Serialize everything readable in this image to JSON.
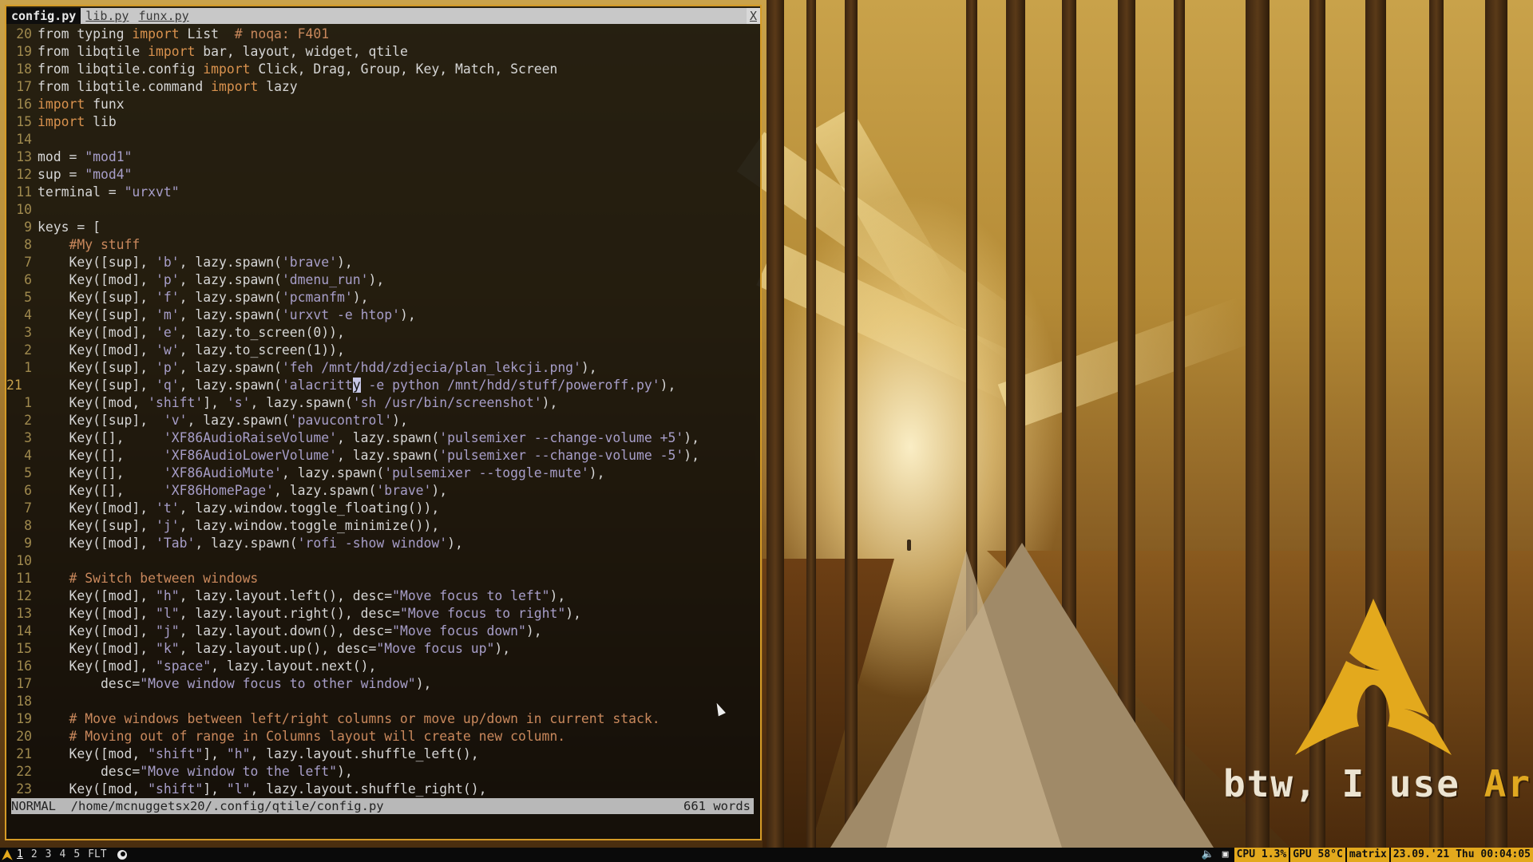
{
  "colors": {
    "accent": "#e3a91d",
    "border": "#d49a26",
    "keyword": "#d9924e",
    "string": "#a79ec9",
    "comment": "#c9885c"
  },
  "editor": {
    "tabs": [
      {
        "label": "config.py",
        "active": true
      },
      {
        "label": "lib.py",
        "active": false
      },
      {
        "label": "funx.py",
        "active": false
      }
    ],
    "close_label": "X",
    "lines": [
      {
        "n": "20",
        "segs": [
          [
            "",
            "from typing "
          ],
          [
            "kw",
            "import"
          ],
          [
            "",
            " List  "
          ],
          [
            "cm",
            "# noqa: F401"
          ]
        ]
      },
      {
        "n": "19",
        "segs": [
          [
            "",
            "from libqtile "
          ],
          [
            "kw",
            "import"
          ],
          [
            "",
            " bar, layout, widget, qtile"
          ]
        ]
      },
      {
        "n": "18",
        "segs": [
          [
            "",
            "from libqtile.config "
          ],
          [
            "kw",
            "import"
          ],
          [
            "",
            " Click, Drag, Group, Key, Match, Screen"
          ]
        ]
      },
      {
        "n": "17",
        "segs": [
          [
            "",
            "from libqtile.command "
          ],
          [
            "kw",
            "import"
          ],
          [
            "",
            " lazy"
          ]
        ]
      },
      {
        "n": "16",
        "segs": [
          [
            "kw",
            "import"
          ],
          [
            "",
            " funx"
          ]
        ]
      },
      {
        "n": "15",
        "segs": [
          [
            "kw",
            "import"
          ],
          [
            "",
            " lib"
          ]
        ]
      },
      {
        "n": "14",
        "segs": []
      },
      {
        "n": "13",
        "segs": [
          [
            "",
            "mod = "
          ],
          [
            "str",
            "\"mod1\""
          ]
        ]
      },
      {
        "n": "12",
        "segs": [
          [
            "",
            "sup = "
          ],
          [
            "str",
            "\"mod4\""
          ]
        ]
      },
      {
        "n": "11",
        "segs": [
          [
            "",
            "terminal = "
          ],
          [
            "str",
            "\"urxvt\""
          ]
        ]
      },
      {
        "n": "10",
        "segs": []
      },
      {
        "n": "9",
        "segs": [
          [
            "",
            "keys = ["
          ]
        ]
      },
      {
        "n": "8",
        "segs": [
          [
            "cm",
            "    #My stuff"
          ]
        ]
      },
      {
        "n": "7",
        "segs": [
          [
            "",
            "    Key([sup], "
          ],
          [
            "str",
            "'b'"
          ],
          [
            "",
            ", lazy.spawn("
          ],
          [
            "str",
            "'brave'"
          ],
          [
            "",
            "),"
          ]
        ]
      },
      {
        "n": "6",
        "segs": [
          [
            "",
            "    Key([mod], "
          ],
          [
            "str",
            "'p'"
          ],
          [
            "",
            ", lazy.spawn("
          ],
          [
            "str",
            "'dmenu_run'"
          ],
          [
            "",
            "),"
          ]
        ]
      },
      {
        "n": "5",
        "segs": [
          [
            "",
            "    Key([sup], "
          ],
          [
            "str",
            "'f'"
          ],
          [
            "",
            ", lazy.spawn("
          ],
          [
            "str",
            "'pcmanfm'"
          ],
          [
            "",
            "),"
          ]
        ]
      },
      {
        "n": "4",
        "segs": [
          [
            "",
            "    Key([sup], "
          ],
          [
            "str",
            "'m'"
          ],
          [
            "",
            ", lazy.spawn("
          ],
          [
            "str",
            "'urxvt -e htop'"
          ],
          [
            "",
            "),"
          ]
        ]
      },
      {
        "n": "3",
        "segs": [
          [
            "",
            "    Key([mod], "
          ],
          [
            "str",
            "'e'"
          ],
          [
            "",
            ", lazy.to_screen(0)),"
          ]
        ]
      },
      {
        "n": "2",
        "segs": [
          [
            "",
            "    Key([mod], "
          ],
          [
            "str",
            "'w'"
          ],
          [
            "",
            ", lazy.to_screen(1)),"
          ]
        ]
      },
      {
        "n": "1",
        "segs": [
          [
            "",
            "    Key([sup], "
          ],
          [
            "str",
            "'p'"
          ],
          [
            "",
            ", lazy.spawn("
          ],
          [
            "str",
            "'feh /mnt/hdd/zdjecia/plan_lekcji.png'"
          ],
          [
            "",
            "),"
          ]
        ]
      },
      {
        "n": "21",
        "cur": true,
        "segs": [
          [
            "",
            "    Key([sup], "
          ],
          [
            "str",
            "'q'"
          ],
          [
            "",
            ", lazy.spawn("
          ],
          [
            "str",
            "'alacritt"
          ],
          [
            "cursor",
            "y"
          ],
          [
            "str",
            " -e python /mnt/hdd/stuff/poweroff.py'"
          ],
          [
            "",
            "),"
          ]
        ]
      },
      {
        "n": "1",
        "segs": [
          [
            "",
            "    Key([mod, "
          ],
          [
            "str",
            "'shift'"
          ],
          [
            "",
            "], "
          ],
          [
            "str",
            "'s'"
          ],
          [
            "",
            ", lazy.spawn("
          ],
          [
            "str",
            "'sh /usr/bin/screenshot'"
          ],
          [
            "",
            "),"
          ]
        ]
      },
      {
        "n": "2",
        "segs": [
          [
            "",
            "    Key([sup],  "
          ],
          [
            "str",
            "'v'"
          ],
          [
            "",
            ", lazy.spawn("
          ],
          [
            "str",
            "'pavucontrol'"
          ],
          [
            "",
            "),"
          ]
        ]
      },
      {
        "n": "3",
        "segs": [
          [
            "",
            "    Key([],     "
          ],
          [
            "str",
            "'XF86AudioRaiseVolume'"
          ],
          [
            "",
            ", lazy.spawn("
          ],
          [
            "str",
            "'pulsemixer --change-volume +5'"
          ],
          [
            "",
            "),"
          ]
        ]
      },
      {
        "n": "4",
        "segs": [
          [
            "",
            "    Key([],     "
          ],
          [
            "str",
            "'XF86AudioLowerVolume'"
          ],
          [
            "",
            ", lazy.spawn("
          ],
          [
            "str",
            "'pulsemixer --change-volume -5'"
          ],
          [
            "",
            "),"
          ]
        ]
      },
      {
        "n": "5",
        "segs": [
          [
            "",
            "    Key([],     "
          ],
          [
            "str",
            "'XF86AudioMute'"
          ],
          [
            "",
            ", lazy.spawn("
          ],
          [
            "str",
            "'pulsemixer --toggle-mute'"
          ],
          [
            "",
            "),"
          ]
        ]
      },
      {
        "n": "6",
        "segs": [
          [
            "",
            "    Key([],     "
          ],
          [
            "str",
            "'XF86HomePage'"
          ],
          [
            "",
            ", lazy.spawn("
          ],
          [
            "str",
            "'brave'"
          ],
          [
            "",
            "),"
          ]
        ]
      },
      {
        "n": "7",
        "segs": [
          [
            "",
            "    Key([mod], "
          ],
          [
            "str",
            "'t'"
          ],
          [
            "",
            ", lazy.window.toggle_floating()),"
          ]
        ]
      },
      {
        "n": "8",
        "segs": [
          [
            "",
            "    Key([sup], "
          ],
          [
            "str",
            "'j'"
          ],
          [
            "",
            ", lazy.window.toggle_minimize()),"
          ]
        ]
      },
      {
        "n": "9",
        "segs": [
          [
            "",
            "    Key([mod], "
          ],
          [
            "str",
            "'Tab'"
          ],
          [
            "",
            ", lazy.spawn("
          ],
          [
            "str",
            "'rofi -show window'"
          ],
          [
            "",
            "),"
          ]
        ]
      },
      {
        "n": "10",
        "segs": []
      },
      {
        "n": "11",
        "segs": [
          [
            "cm",
            "    # Switch between windows"
          ]
        ]
      },
      {
        "n": "12",
        "segs": [
          [
            "",
            "    Key([mod], "
          ],
          [
            "str",
            "\"h\""
          ],
          [
            "",
            ", lazy.layout.left(), desc="
          ],
          [
            "str",
            "\"Move focus to left\""
          ],
          [
            "",
            "),"
          ]
        ]
      },
      {
        "n": "13",
        "segs": [
          [
            "",
            "    Key([mod], "
          ],
          [
            "str",
            "\"l\""
          ],
          [
            "",
            ", lazy.layout.right(), desc="
          ],
          [
            "str",
            "\"Move focus to right\""
          ],
          [
            "",
            "),"
          ]
        ]
      },
      {
        "n": "14",
        "segs": [
          [
            "",
            "    Key([mod], "
          ],
          [
            "str",
            "\"j\""
          ],
          [
            "",
            ", lazy.layout.down(), desc="
          ],
          [
            "str",
            "\"Move focus down\""
          ],
          [
            "",
            "),"
          ]
        ]
      },
      {
        "n": "15",
        "segs": [
          [
            "",
            "    Key([mod], "
          ],
          [
            "str",
            "\"k\""
          ],
          [
            "",
            ", lazy.layout.up(), desc="
          ],
          [
            "str",
            "\"Move focus up\""
          ],
          [
            "",
            "),"
          ]
        ]
      },
      {
        "n": "16",
        "segs": [
          [
            "",
            "    Key([mod], "
          ],
          [
            "str",
            "\"space\""
          ],
          [
            "",
            ", lazy.layout.next(),"
          ]
        ]
      },
      {
        "n": "17",
        "segs": [
          [
            "",
            "        desc="
          ],
          [
            "str",
            "\"Move window focus to other window\""
          ],
          [
            "",
            "),"
          ]
        ]
      },
      {
        "n": "18",
        "segs": []
      },
      {
        "n": "19",
        "segs": [
          [
            "cm",
            "    # Move windows between left/right columns or move up/down in current stack."
          ]
        ]
      },
      {
        "n": "20",
        "segs": [
          [
            "cm",
            "    # Moving out of range in Columns layout will create new column."
          ]
        ]
      },
      {
        "n": "21",
        "segs": [
          [
            "",
            "    Key([mod, "
          ],
          [
            "str",
            "\"shift\""
          ],
          [
            "",
            "], "
          ],
          [
            "str",
            "\"h\""
          ],
          [
            "",
            ", lazy.layout.shuffle_left(),"
          ]
        ]
      },
      {
        "n": "22",
        "segs": [
          [
            "",
            "        desc="
          ],
          [
            "str",
            "\"Move window to the left\""
          ],
          [
            "",
            "),"
          ]
        ]
      },
      {
        "n": "23",
        "segs": [
          [
            "",
            "    Key([mod, "
          ],
          [
            "str",
            "\"shift\""
          ],
          [
            "",
            "], "
          ],
          [
            "str",
            "\"l\""
          ],
          [
            "",
            ", lazy.layout.shuffle_right(),"
          ]
        ]
      }
    ],
    "status": {
      "mode": "NORMAL",
      "path": "/home/mcnuggetsx20/.config/qtile/config.py",
      "words": "661 words"
    }
  },
  "wallpaper": {
    "slogan_prefix": "btw, I use ",
    "slogan_word": "Arch"
  },
  "bar": {
    "groups": [
      "1",
      "2",
      "3",
      "4",
      "5"
    ],
    "active_group": "1",
    "layout": "FLT",
    "widgets": {
      "cpu": "CPU 1.3%",
      "gpu": "GPU 58°C",
      "theme": "matrix",
      "clock": "23.09.'21 Thu 00:04:05"
    },
    "icons": {
      "launcher": "arch-icon",
      "window": "window-app-icon",
      "volume": "speaker-icon",
      "tray": "display-icon"
    }
  }
}
